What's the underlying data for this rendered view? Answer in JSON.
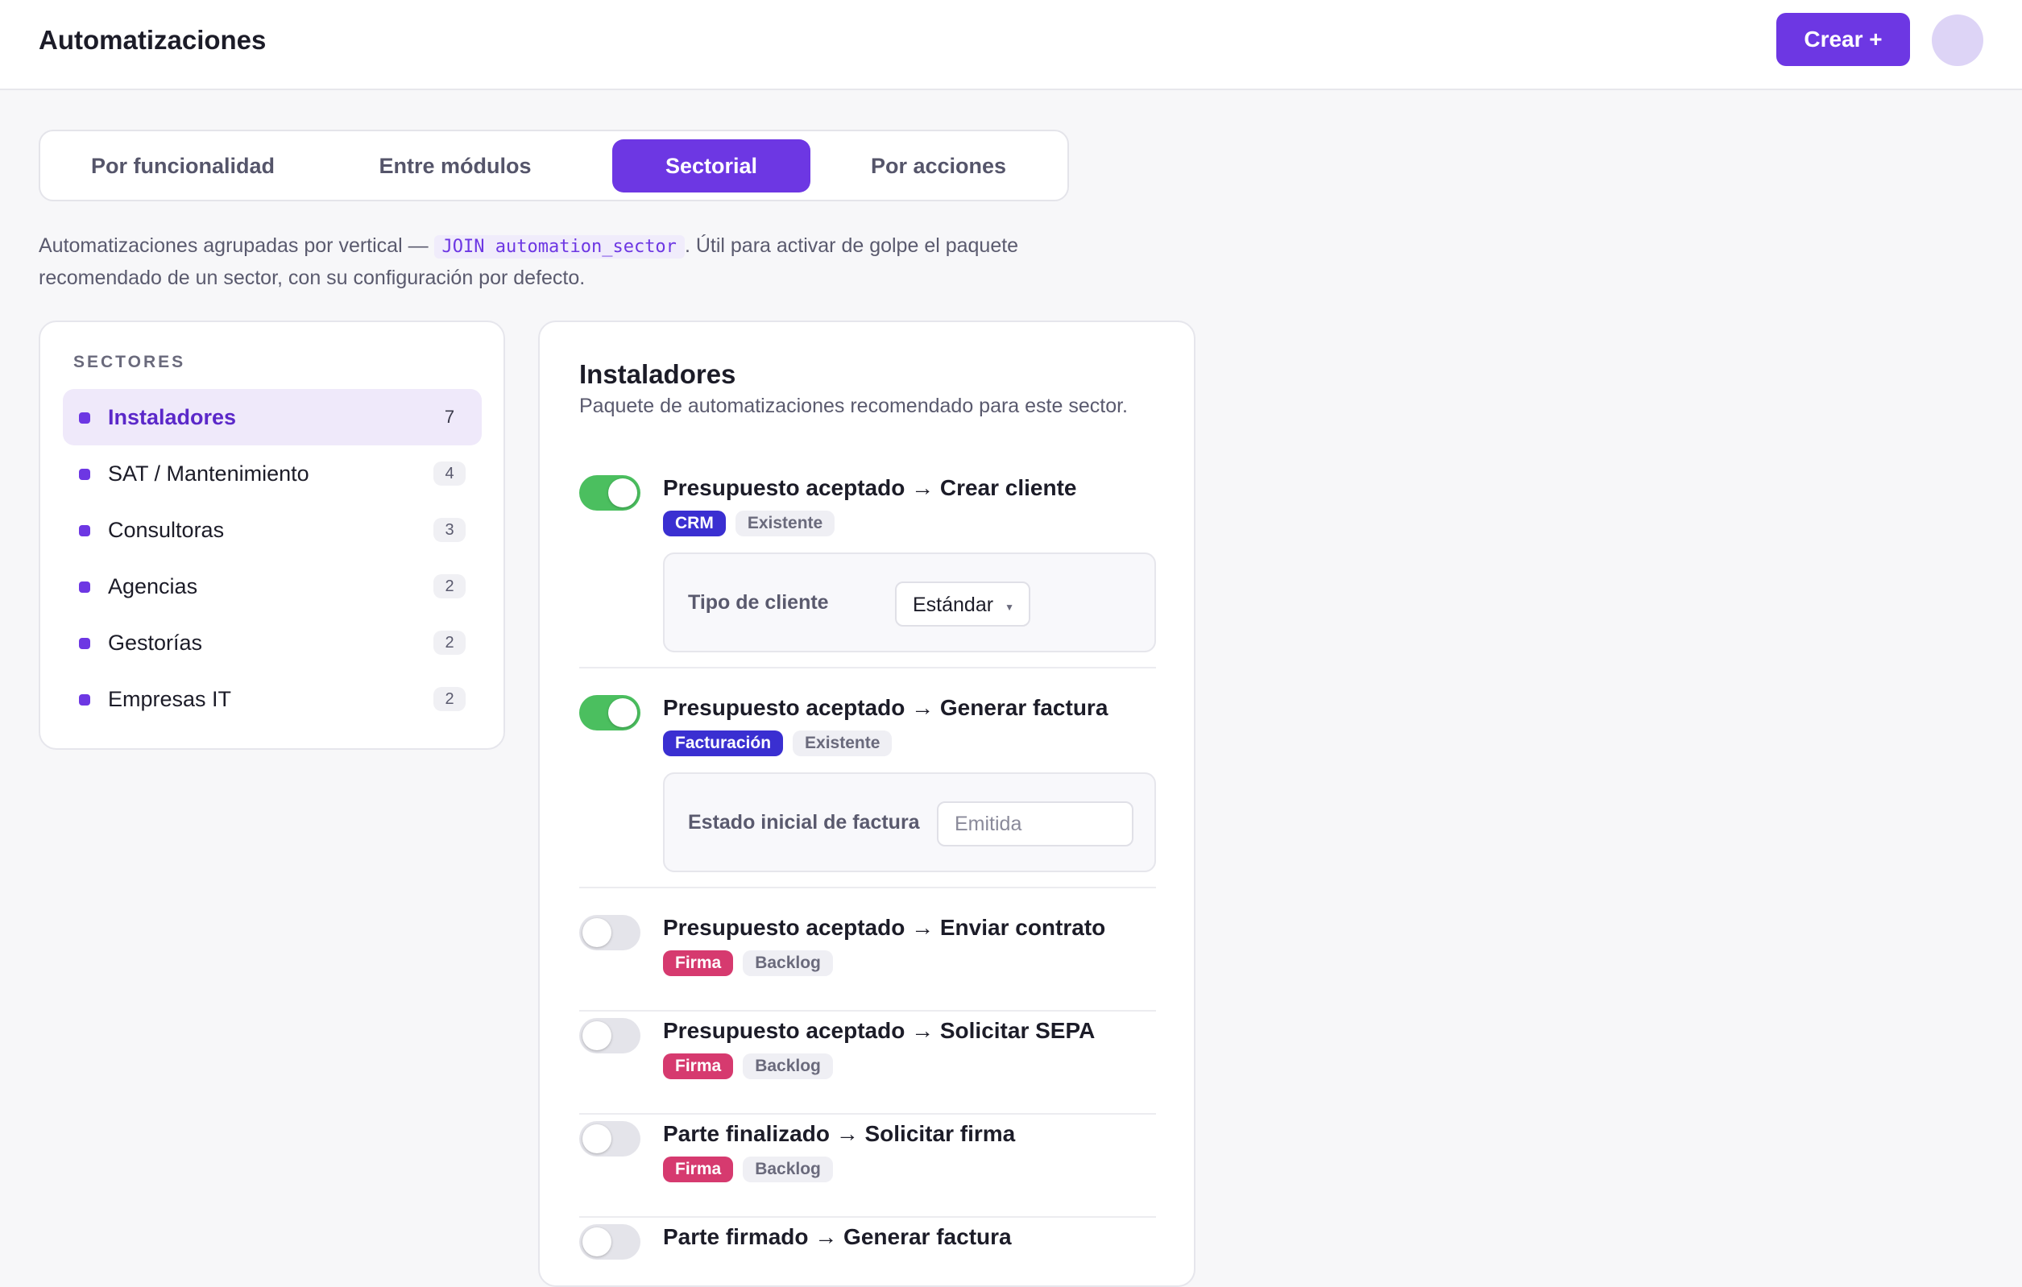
{
  "header": {
    "title": "Automatizaciones",
    "create_label": "Crear +"
  },
  "tabs": [
    {
      "label": "Por funcionalidad",
      "active": false
    },
    {
      "label": "Entre módulos",
      "active": false
    },
    {
      "label": "Sectorial",
      "active": true
    },
    {
      "label": "Por acciones",
      "active": false
    }
  ],
  "description": {
    "before": "Automatizaciones agrupadas por vertical — ",
    "code": "JOIN automation_sector",
    "after": ". Útil para activar de golpe el paquete recomendado de un sector, con su configuración por defecto."
  },
  "sectors": {
    "heading": "SECTORES",
    "items": [
      {
        "name": "Instaladores",
        "count": "7",
        "active": true
      },
      {
        "name": "SAT / Mantenimiento",
        "count": "4",
        "active": false
      },
      {
        "name": "Consultoras",
        "count": "3",
        "active": false
      },
      {
        "name": "Agencias",
        "count": "2",
        "active": false
      },
      {
        "name": "Gestorías",
        "count": "2",
        "active": false
      },
      {
        "name": "Empresas IT",
        "count": "2",
        "active": false
      }
    ]
  },
  "panel": {
    "title": "Instaladores",
    "subtitle": "Paquete de automatizaciones recomendado para este sector.",
    "automations": [
      {
        "title": "Presupuesto aceptado → Crear cliente",
        "enabled": true,
        "module_tag": "CRM",
        "status_tag": "Existente",
        "config": {
          "label": "Tipo de cliente",
          "type": "select",
          "value": "Estándar"
        }
      },
      {
        "title": "Presupuesto aceptado → Generar factura",
        "enabled": true,
        "module_tag": "Facturación",
        "status_tag": "Existente",
        "config": {
          "label": "Estado inicial de factura",
          "type": "input",
          "placeholder": "Emitida"
        }
      },
      {
        "title": "Presupuesto aceptado → Enviar contrato",
        "enabled": false,
        "module_tag": "Firma",
        "status_tag": "Backlog"
      },
      {
        "title": "Presupuesto aceptado → Solicitar SEPA",
        "enabled": false,
        "module_tag": "Firma",
        "status_tag": "Backlog"
      },
      {
        "title": "Parte finalizado → Solicitar firma",
        "enabled": false,
        "module_tag": "Firma",
        "status_tag": "Backlog"
      },
      {
        "title": "Parte firmado → Generar factura",
        "enabled": false
      }
    ]
  },
  "colors": {
    "accent": "#6d37e3",
    "toggle_on": "#4bbf5f",
    "tag_blue": "#3a2fd1",
    "tag_pink": "#d63a6f"
  }
}
